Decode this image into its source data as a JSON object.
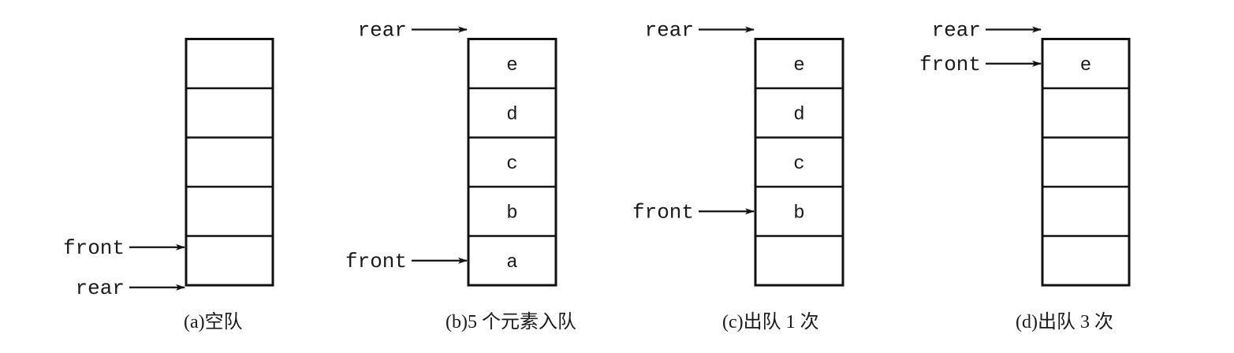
{
  "diagrams": [
    {
      "caption": "(a)空队",
      "cells": [
        "",
        "",
        "",
        "",
        ""
      ],
      "pointers": [
        {
          "label": "front",
          "slot": 0
        },
        {
          "label": "rear",
          "slot": 0
        }
      ]
    },
    {
      "caption": "(b)5 个元素入队",
      "cells": [
        "a",
        "b",
        "c",
        "d",
        "e"
      ],
      "pointers": [
        {
          "label": "rear",
          "slot": 5
        },
        {
          "label": "front",
          "slot": 0
        }
      ]
    },
    {
      "caption": "(c)出队 1 次",
      "cells": [
        "",
        "b",
        "c",
        "d",
        "e"
      ],
      "pointers": [
        {
          "label": "rear",
          "slot": 5
        },
        {
          "label": "front",
          "slot": 1
        }
      ]
    },
    {
      "caption": "(d)出队 3 次",
      "cells": [
        "",
        "",
        "",
        "",
        "e"
      ],
      "pointers": [
        {
          "label": "rear",
          "slot": 5
        },
        {
          "label": "front",
          "slot": 4
        }
      ]
    }
  ],
  "colors": {
    "stroke": "#111111",
    "text": "#1a1a1a",
    "background": "#ffffff"
  }
}
